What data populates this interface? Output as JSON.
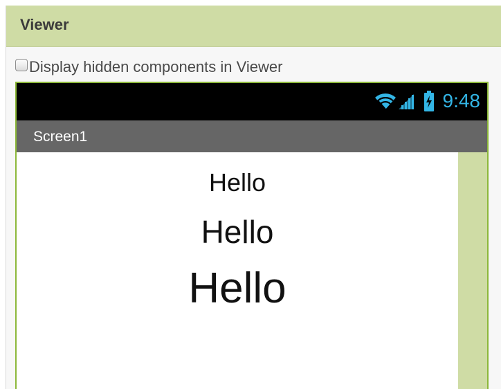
{
  "viewer": {
    "title": "Viewer",
    "display_hidden_label": "Display hidden components in Viewer",
    "display_hidden_checked": false
  },
  "phone": {
    "status_bar": {
      "time": "9:48",
      "icons": [
        "wifi-icon",
        "signal-icon",
        "battery-charging-icon"
      ],
      "accent_color": "#33b5e5"
    },
    "screen_title": "Screen1",
    "labels": [
      {
        "text": "Hello"
      },
      {
        "text": "Hello"
      },
      {
        "text": "Hello"
      }
    ]
  },
  "colors": {
    "header_bg": "#cfdca5",
    "phone_border": "#8cb83a",
    "title_bar_bg": "#666666",
    "status_bar_bg": "#000000"
  }
}
